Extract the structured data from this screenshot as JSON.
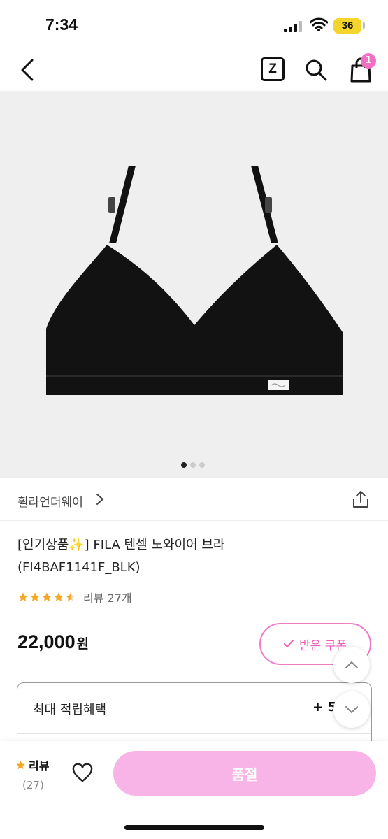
{
  "status_bar": {
    "time": "7:34",
    "battery": "36"
  },
  "nav": {
    "z_label": "Z",
    "cart_count": "1"
  },
  "gallery": {
    "total": 3,
    "active": 0
  },
  "brand": {
    "name": "휠라언더웨어"
  },
  "product": {
    "title_line1": "[인기상품✨] FILA 텐셀 노와이어 브라",
    "title_line2": "(FI4BAF1141F_BLK)",
    "rating": 4.5,
    "review_link": "리뷰 27개",
    "price": "22,000",
    "price_unit": "원"
  },
  "coupon": {
    "label": "받은 쿠폰"
  },
  "points": {
    "label": "최대 적립혜택",
    "value": "+ 5"
  },
  "bottom": {
    "review_label": "리뷰",
    "review_count": "(27)",
    "buy_label": "품절"
  },
  "colors": {
    "accent": "#ee5db8",
    "soldout_bg": "#f8b4e6",
    "star": "#f5a623"
  }
}
